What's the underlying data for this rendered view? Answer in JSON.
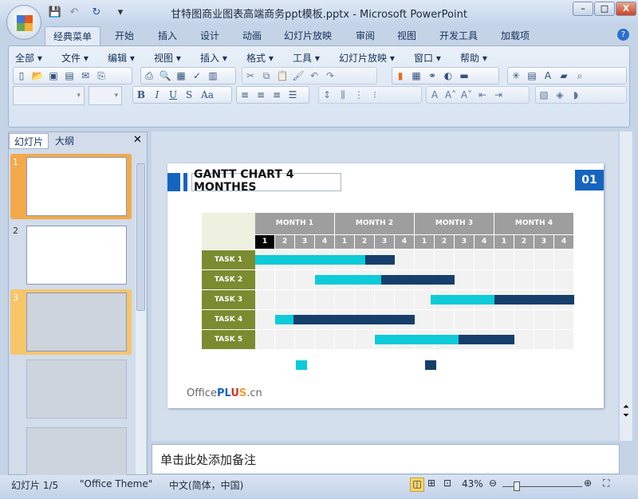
{
  "window": {
    "title": "甘特图商业图表高端商务ppt模板.pptx - Microsoft PowerPoint",
    "minimize": "–",
    "maximize": "□",
    "close": "X"
  },
  "quick_access": [
    {
      "icon": "save-icon",
      "glyph": "💾"
    },
    {
      "icon": "undo-icon",
      "glyph": "↶"
    },
    {
      "icon": "redo-icon",
      "glyph": "↻"
    },
    {
      "icon": "customize-icon",
      "glyph": "▾"
    }
  ],
  "ribbon_tabs": [
    "经典菜单",
    "开始",
    "插入",
    "设计",
    "动画",
    "幻灯片放映",
    "审阅",
    "视图",
    "开发工具",
    "加载项"
  ],
  "help_glyph": "?",
  "menus": [
    "全部",
    "文件",
    "编辑",
    "视图",
    "插入",
    "格式",
    "工具",
    "幻灯片放映",
    "窗口",
    "帮助"
  ],
  "format_buttons": [
    "B",
    "I",
    "U",
    "S",
    "Aa"
  ],
  "left_pane": {
    "tabs": [
      "幻灯片",
      "大纲"
    ],
    "close": "✕",
    "slides": [
      "1",
      "2",
      "3"
    ]
  },
  "slide": {
    "title": "GANTT CHART  4 MONTHES",
    "number": "01",
    "logo": "OfficePLUS.cn",
    "accent": "#1565c0"
  },
  "chart_data": {
    "type": "gantt",
    "months": [
      "MONTH 1",
      "MONTH 2",
      "MONTH 3",
      "MONTH 4"
    ],
    "weeks": [
      "1",
      "2",
      "3",
      "4"
    ],
    "tasks": [
      {
        "name": "TASK 1",
        "start": 0,
        "mid": 5.5,
        "end": 7
      },
      {
        "name": "TASK 2",
        "start": 3,
        "mid": 6.3,
        "end": 10
      },
      {
        "name": "TASK 3",
        "start": 8.8,
        "mid": 12,
        "end": 16
      },
      {
        "name": "TASK 4",
        "start": 1,
        "mid": 1.9,
        "end": 8
      },
      {
        "name": "TASK 5",
        "start": 6,
        "mid": 10.2,
        "end": 13
      }
    ],
    "x_range_weeks": [
      0,
      16
    ],
    "colors": {
      "phase1": "#0dcbd8",
      "phase2": "#173f6b",
      "task_label": "#7b8b30",
      "header": "#9e9e9e",
      "grid": "#f2f2f2"
    }
  },
  "notes_placeholder": "单击此处添加备注",
  "status": {
    "slide": "幻灯片 1/5",
    "theme": "\"Office Theme\"",
    "language": "中文(简体，中国)",
    "zoom": "43%",
    "zoom_percent": 43
  }
}
